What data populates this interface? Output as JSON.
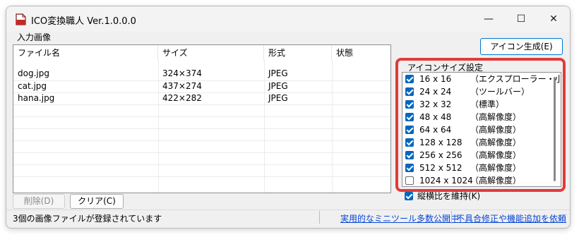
{
  "window": {
    "title": "ICO変換職人 Ver.1.0.0.0",
    "controls": {
      "minimize": "—",
      "maximize": "☐",
      "close": "✕"
    }
  },
  "input_group": {
    "label": "入力画像",
    "columns": [
      "ファイル名",
      "サイズ",
      "形式",
      "状態"
    ],
    "rows": [
      {
        "name": "dog.jpg",
        "size": "324×374",
        "format": "JPEG",
        "status": ""
      },
      {
        "name": "cat.jpg",
        "size": "437×274",
        "format": "JPEG",
        "status": ""
      },
      {
        "name": "hana.jpg",
        "size": "422×282",
        "format": "JPEG",
        "status": ""
      }
    ]
  },
  "buttons": {
    "delete": "削除(D)",
    "clear": "クリア(C)",
    "generate": "アイコン生成(E)"
  },
  "icon_sizes": {
    "label": "アイコンサイズ設定",
    "items": [
      {
        "size": "16 x 16",
        "desc": "（エクスプローラー・小）",
        "checked": true
      },
      {
        "size": "24 x 24",
        "desc": "（ツールバー）",
        "checked": true
      },
      {
        "size": "32 x 32",
        "desc": "（標準）",
        "checked": true
      },
      {
        "size": "48 x 48",
        "desc": "（高解像度）",
        "checked": true
      },
      {
        "size": "64 x 64",
        "desc": "（高解像度）",
        "checked": true
      },
      {
        "size": "128 x 128",
        "desc": "（高解像度）",
        "checked": true
      },
      {
        "size": "256 x 256",
        "desc": "（高解像度）",
        "checked": true
      },
      {
        "size": "512 x 512",
        "desc": "（高解像度）",
        "checked": true
      },
      {
        "size": "1024 x 1024",
        "desc": "（高解像度）",
        "checked": false
      }
    ],
    "keep_aspect": {
      "label": "縦横比を維持(K)",
      "checked": true
    }
  },
  "statusbar": {
    "message": "3個の画像ファイルが登録されています",
    "link1": "実用的なミニツール多数公開中",
    "link2": "不具合修正や機能追加を依頼"
  },
  "colors": {
    "accent": "#0067c0",
    "highlight": "#e23b3b",
    "link": "#0645d6"
  }
}
